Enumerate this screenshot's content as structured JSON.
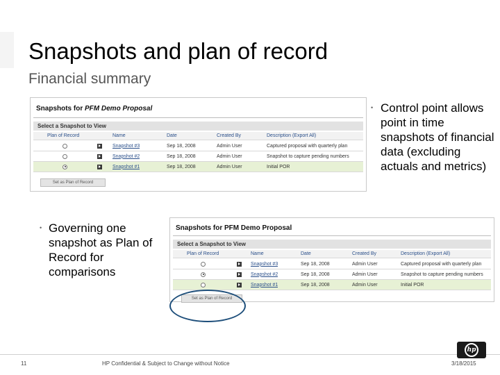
{
  "slide": {
    "title": "Snapshots and plan of record",
    "subtitle": "Financial summary",
    "page_number": "11",
    "footer_text": "HP Confidential & Subject to Change without Notice",
    "footer_date": "3/18/2015"
  },
  "bullets": {
    "right": "Control point allows point in time snapshots of financial data (excluding actuals and metrics)",
    "left": "Governing one snapshot as Plan of Record for comparisons"
  },
  "panel_top": {
    "title_prefix": "Snapshots for",
    "title_name": "PFM Demo Proposal",
    "section_label": "Select a Snapshot to View",
    "columns": [
      "Plan of Record",
      "Name",
      "Date",
      "Created By",
      "Description (Export All)"
    ],
    "rows": [
      {
        "selected": false,
        "name": "Snapshot #3",
        "date": "Sep 18, 2008",
        "created_by": "Admin User",
        "description": "Captured proposal with quarterly plan"
      },
      {
        "selected": false,
        "name": "Snapshot #2",
        "date": "Sep 18, 2008",
        "created_by": "Admin User",
        "description": "Snapshot to capture pending numbers"
      },
      {
        "selected": true,
        "name": "Snapshot #1",
        "date": "Sep 18, 2008",
        "created_by": "Admin User",
        "description": "Initial POR"
      }
    ],
    "button_label": "Set as Plan of Record"
  },
  "panel_bottom": {
    "title": "Snapshots for PFM Demo Proposal",
    "section_label": "Select a Snapshot to View",
    "columns": [
      "Plan of Record",
      "Name",
      "Date",
      "Created By",
      "Description (Export All)"
    ],
    "rows": [
      {
        "selected": false,
        "name": "Snapshot #3",
        "date": "Sep 18, 2008",
        "created_by": "Admin User",
        "description": "Captured proposal with quarterly plan"
      },
      {
        "selected": true,
        "name": "Snapshot #2",
        "date": "Sep 18, 2008",
        "created_by": "Admin User",
        "description": "Snapshot to capture pending numbers"
      },
      {
        "selected": false,
        "name": "Snapshot #1",
        "date": "Sep 18, 2008",
        "created_by": "Admin User",
        "description": "Initial POR"
      }
    ],
    "button_label": "Set as Plan of Record"
  },
  "brand": {
    "logo_text": "hp"
  }
}
